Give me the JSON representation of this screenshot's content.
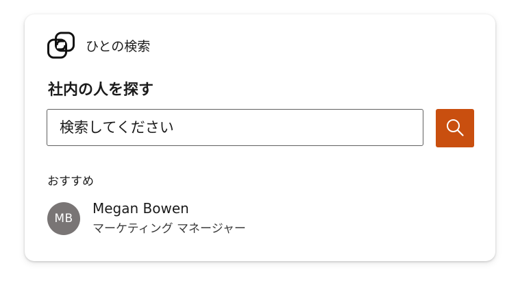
{
  "header": {
    "title": "ひとの検索",
    "icon": "people-search-logo-icon"
  },
  "section": {
    "title": "社内の人を探す"
  },
  "search": {
    "placeholder": "検索してください",
    "button_icon": "search-icon",
    "button_color": "#c94f0f"
  },
  "recommendations": {
    "label": "おすすめ",
    "people": [
      {
        "initials": "MB",
        "name": "Megan Bowen",
        "title": "マーケティング マネージャー",
        "avatar_color": "#797575"
      }
    ]
  }
}
